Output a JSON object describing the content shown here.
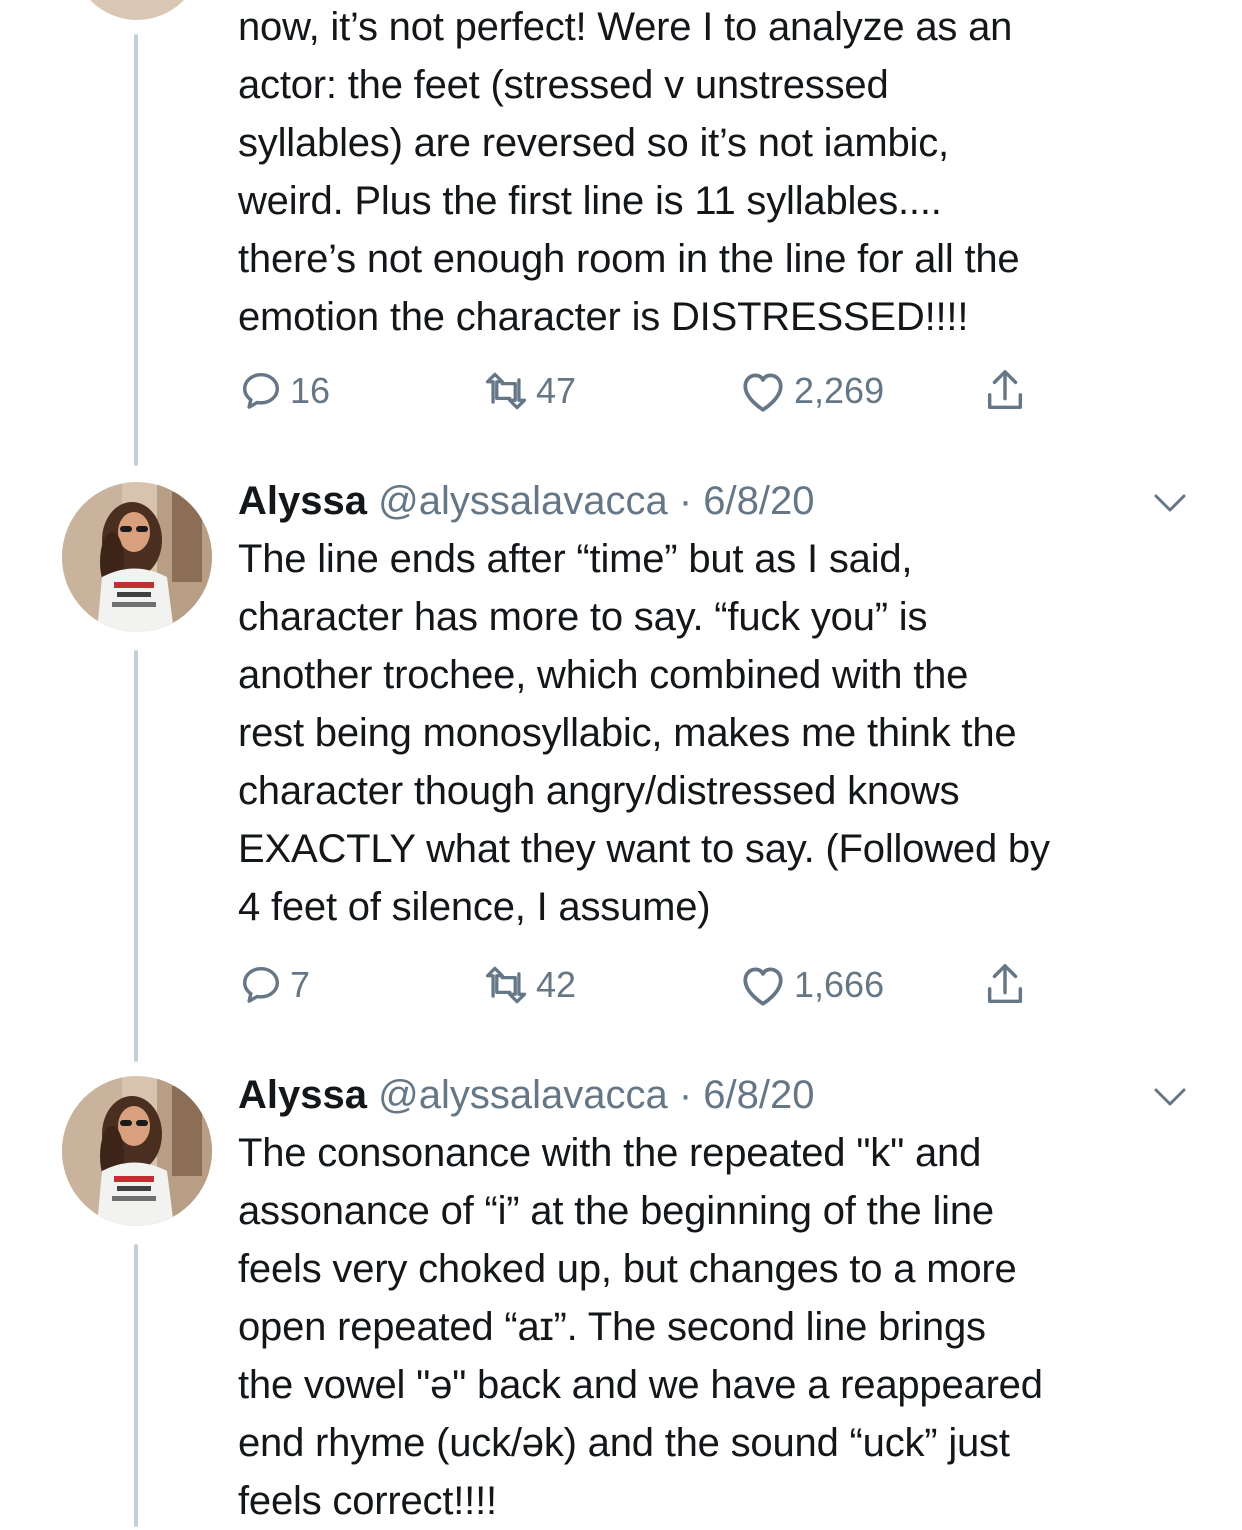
{
  "tweets": [
    {
      "text": "now, it’s not perfect! Were I to analyze as an\nactor: the feet (stressed v unstressed\nsyllables) are reversed so it’s not iambic,\nweird. Plus the first line is 11 syllables....\nthere’s not enough room in the line for all the\nemotion the character is DISTRESSED!!!!",
      "replies": "16",
      "retweets": "47",
      "likes": "2,269"
    },
    {
      "name": "Alyssa",
      "handle": "@alyssalavacca",
      "separator": "·",
      "date": "6/8/20",
      "text": "The line ends after “time” but as I said,\ncharacter has more to say. “fuck you” is\nanother trochee, which combined with the\nrest being monosyllabic, makes me think the\ncharacter though angry/distressed knows\nEXACTLY what they want to say. (Followed by\n4 feet of silence, I assume)",
      "replies": "7",
      "retweets": "42",
      "likes": "1,666"
    },
    {
      "name": "Alyssa",
      "handle": "@alyssalavacca",
      "separator": "·",
      "date": "6/8/20",
      "text": "The consonance with the repeated \"k\" and\nassonance of “i” at the beginning of the line\nfeels very choked up, but changes to a more\nopen repeated “aɪ”. The second line brings\nthe vowel \"ə\" back and we have a reappeared\nend rhyme (uck/ək) and the sound “uck” just\nfeels correct!!!!"
    }
  ],
  "icons": {
    "reply": "reply-bubble-icon",
    "retweet": "retweet-icon",
    "like": "heart-icon",
    "share": "share-icon",
    "caret": "chevron-down-icon"
  },
  "colors": {
    "text": "#14171a",
    "secondary": "#657786",
    "thread_line": "#c4cfd6"
  }
}
